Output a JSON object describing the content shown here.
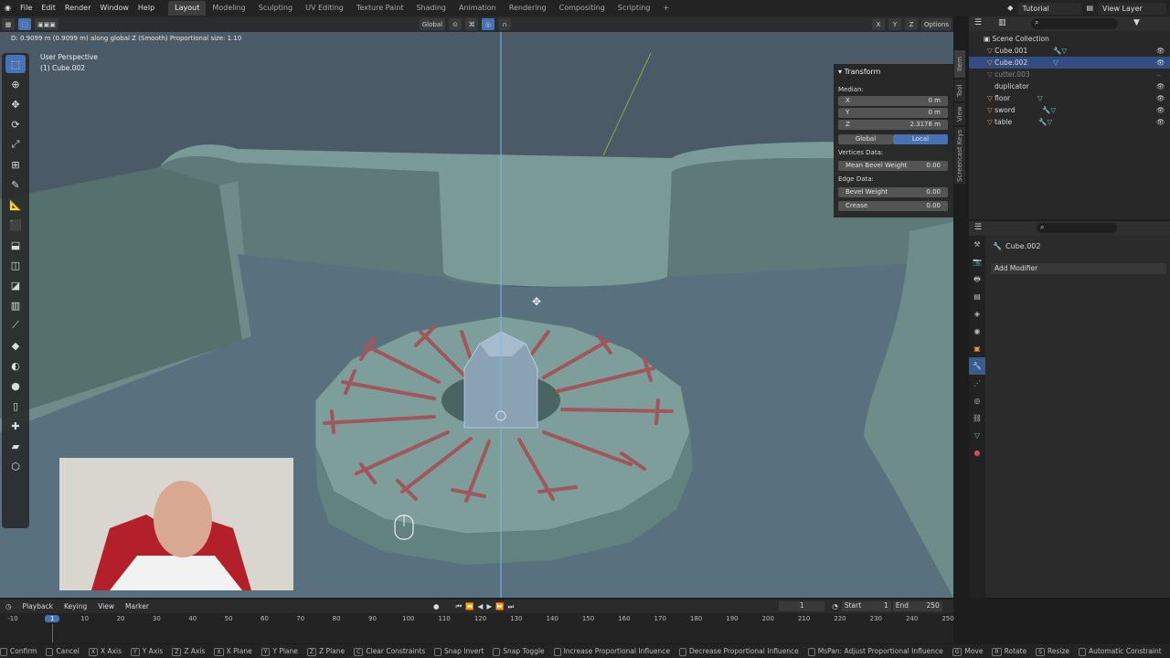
{
  "topbar": {
    "menus": [
      "File",
      "Edit",
      "Render",
      "Window",
      "Help"
    ],
    "workspaces": [
      "Layout",
      "Modeling",
      "Sculpting",
      "UV Editing",
      "Texture Paint",
      "Shading",
      "Animation",
      "Rendering",
      "Compositing",
      "Scripting"
    ],
    "active_workspace": "Layout",
    "scene_name": "Tutorial",
    "view_layer": "View Layer"
  },
  "viewport": {
    "header_status": "D: 0.9099 m (0.9099 m) along global Z (Smooth)  Proportional size: 1.10",
    "transform_orientation": "Global",
    "options_label": "Options",
    "axis_x": "X",
    "axis_y": "Y",
    "axis_z": "Z",
    "view_name": "User Perspective",
    "object_label": "(1) Cube.002",
    "tabs": [
      "Item",
      "Tool",
      "View",
      "Screencast Keys"
    ]
  },
  "npanel": {
    "section": "Transform",
    "median_label": "Median:",
    "x_label": "X",
    "x_value": "0 m",
    "y_label": "Y",
    "y_value": "0 m",
    "z_label": "Z",
    "z_value": "2.3178 m",
    "global_label": "Global",
    "local_label": "Local",
    "vertices_data": "Vertices Data:",
    "mean_bevel_weight_label": "Mean Bevel Weight",
    "mean_bevel_weight_value": "0.00",
    "edge_data": "Edge Data:",
    "bevel_weight_label": "Bevel Weight",
    "bevel_weight_value": "0.00",
    "crease_label": "Crease",
    "crease_value": "0.00"
  },
  "outliner": {
    "root": "Scene Collection",
    "items": [
      {
        "name": "Cube.001"
      },
      {
        "name": "Cube.002"
      },
      {
        "name": "cutter.003"
      },
      {
        "name": "duplicator"
      },
      {
        "name": "floor"
      },
      {
        "name": "sword"
      },
      {
        "name": "table"
      }
    ]
  },
  "properties": {
    "object_name": "Cube.002",
    "add_modifier": "Add Modifier"
  },
  "timeline": {
    "menus": [
      "Playback",
      "Keying",
      "View",
      "Marker"
    ],
    "current_frame": "1",
    "start_label": "Start",
    "start_value": "1",
    "end_label": "End",
    "end_value": "250",
    "ticks": [
      "-10",
      "1",
      "10",
      "20",
      "30",
      "40",
      "50",
      "60",
      "70",
      "80",
      "90",
      "100",
      "110",
      "120",
      "130",
      "140",
      "150",
      "160",
      "170",
      "180",
      "190",
      "200",
      "210",
      "220",
      "230",
      "240",
      "250"
    ],
    "tick_frames": [
      -10,
      1,
      10,
      20,
      30,
      40,
      50,
      60,
      70,
      80,
      90,
      100,
      110,
      120,
      130,
      140,
      150,
      160,
      170,
      180,
      190,
      200,
      210,
      220,
      230,
      240,
      250
    ]
  },
  "statusbar": {
    "items": [
      {
        "key": "",
        "label": "Confirm"
      },
      {
        "key": "",
        "label": "Cancel"
      },
      {
        "key": "X",
        "label": "X Axis"
      },
      {
        "key": "Y",
        "label": "Y Axis"
      },
      {
        "key": "Z",
        "label": "Z Axis"
      },
      {
        "key": "X",
        "label": "X Plane"
      },
      {
        "key": "Y",
        "label": "Y Plane"
      },
      {
        "key": "Z",
        "label": "Z Plane"
      },
      {
        "key": "C",
        "label": "Clear Constraints"
      },
      {
        "key": "",
        "label": "Snap Invert"
      },
      {
        "key": "",
        "label": "Snap Toggle"
      },
      {
        "key": "",
        "label": "Increase Proportional Influence"
      },
      {
        "key": "",
        "label": "Decrease Proportional Influence"
      },
      {
        "key": "",
        "label": "MsPan: Adjust Proportional Influence"
      },
      {
        "key": "G",
        "label": "Move"
      },
      {
        "key": "R",
        "label": "Rotate"
      },
      {
        "key": "S",
        "label": "Resize"
      },
      {
        "key": "",
        "label": "Automatic Constraint"
      }
    ]
  },
  "colors": {
    "accent": "#4772b3",
    "viewport_bg": "#4a5a66",
    "mesh": "#6b8c8a",
    "blade": "#a0565a"
  }
}
